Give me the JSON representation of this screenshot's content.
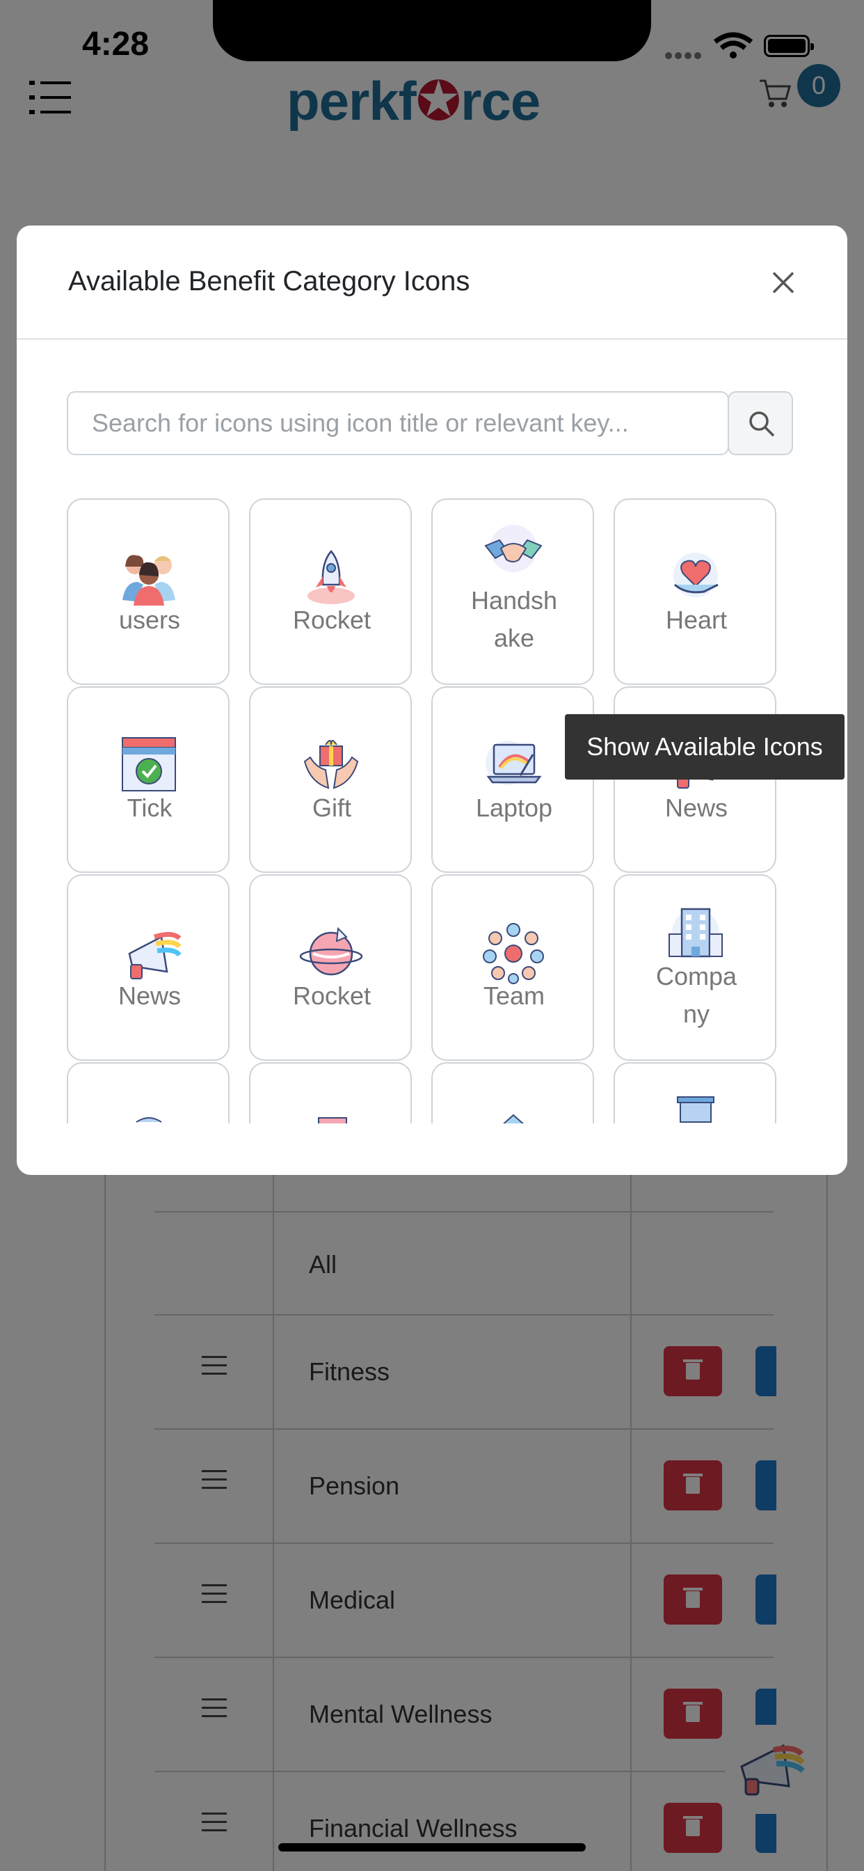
{
  "status_bar": {
    "time": "4:28"
  },
  "navbar": {
    "logo": "perkforce",
    "cart_count": "0"
  },
  "background_table": {
    "rows": [
      {
        "label": "All"
      },
      {
        "label": "Fitness"
      },
      {
        "label": "Pension"
      },
      {
        "label": "Medical"
      },
      {
        "label": "Mental Wellness"
      },
      {
        "label": "Financial Wellness"
      }
    ]
  },
  "modal": {
    "title": "Available Benefit Category Icons",
    "search_placeholder": "Search for icons using icon title or relevant key...",
    "tooltip": "Show Available Icons",
    "icons": [
      {
        "label": "users",
        "icon": "users-icon"
      },
      {
        "label": "Rocket",
        "icon": "rocket-icon"
      },
      {
        "label": "Handsh\nake",
        "icon": "handshake-icon"
      },
      {
        "label": "Heart",
        "icon": "heart-icon"
      },
      {
        "label": "Tick",
        "icon": "tick-icon"
      },
      {
        "label": "Gift",
        "icon": "gift-icon"
      },
      {
        "label": "Laptop",
        "icon": "laptop-icon"
      },
      {
        "label": "News",
        "icon": "news-icon"
      },
      {
        "label": "News",
        "icon": "news-icon"
      },
      {
        "label": "Rocket",
        "icon": "rocket-planet-icon"
      },
      {
        "label": "Team",
        "icon": "team-icon"
      },
      {
        "label": "Compa\nny",
        "icon": "company-icon"
      }
    ]
  }
}
